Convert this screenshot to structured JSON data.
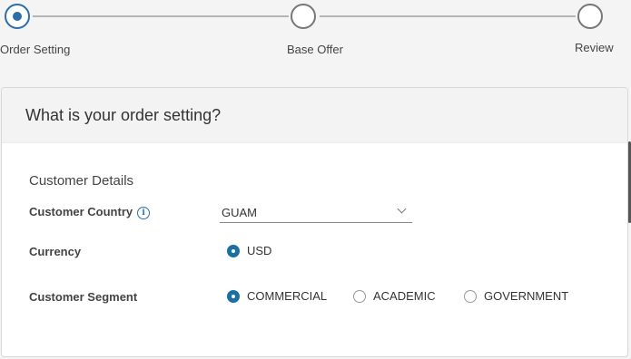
{
  "stepper": {
    "steps": [
      {
        "label": "Order Setting",
        "state": "active"
      },
      {
        "label": "Base Offer",
        "state": "inactive"
      },
      {
        "label": "Review",
        "state": "inactive"
      }
    ]
  },
  "card": {
    "title": "What is your order setting?",
    "section_title": "Customer Details",
    "fields": {
      "country": {
        "label": "Customer Country",
        "info_icon": "info-icon",
        "value": "GUAM"
      },
      "currency": {
        "label": "Currency",
        "options": [
          {
            "label": "USD",
            "selected": true
          }
        ]
      },
      "segment": {
        "label": "Customer Segment",
        "options": [
          {
            "label": "COMMERCIAL",
            "selected": true
          },
          {
            "label": "ACADEMIC",
            "selected": false
          },
          {
            "label": "GOVERNMENT",
            "selected": false
          }
        ]
      }
    }
  },
  "colors": {
    "accent": "#2c6fa8",
    "radio_checked": "#1a6fa3"
  }
}
